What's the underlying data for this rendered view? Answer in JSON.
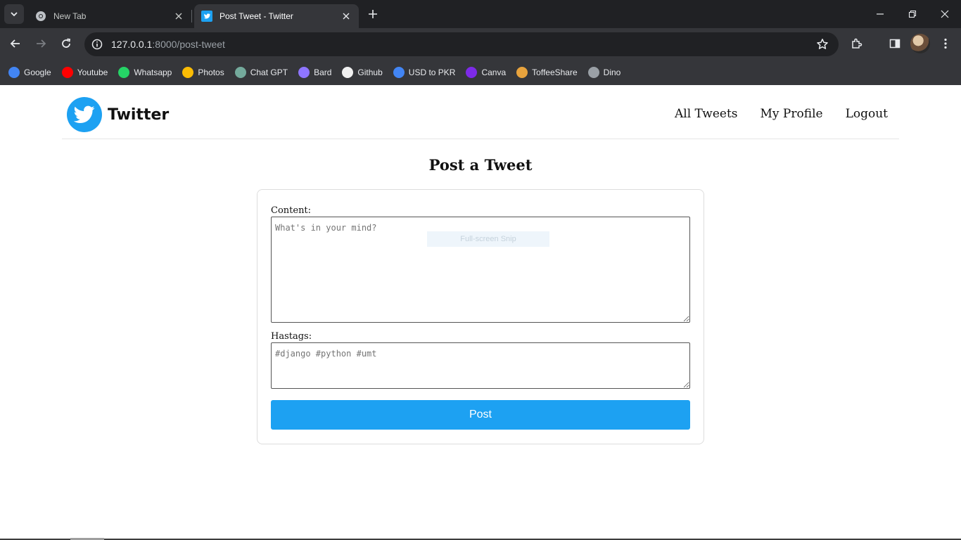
{
  "browser": {
    "tabs": [
      {
        "title": "New Tab",
        "favicon": "chrome-icon",
        "active": false
      },
      {
        "title": "Post Tweet - Twitter",
        "favicon": "twitter-bird-icon",
        "active": true
      }
    ],
    "address": {
      "host": "127.0.0.1",
      "path": ":8000/post-tweet"
    },
    "bookmarks": [
      {
        "label": "Google",
        "icon": "google-icon",
        "color": "#4285f4"
      },
      {
        "label": "Youtube",
        "icon": "youtube-icon",
        "color": "#ff0000"
      },
      {
        "label": "Whatsapp",
        "icon": "whatsapp-icon",
        "color": "#25d366"
      },
      {
        "label": "Photos",
        "icon": "photos-icon",
        "color": "#fbbc04"
      },
      {
        "label": "Chat GPT",
        "icon": "chatgpt-icon",
        "color": "#74aa9c"
      },
      {
        "label": "Bard",
        "icon": "bard-icon",
        "color": "#8e75ff"
      },
      {
        "label": "Github",
        "icon": "github-icon",
        "color": "#f0f0f0"
      },
      {
        "label": "USD to PKR",
        "icon": "google-icon",
        "color": "#4285f4"
      },
      {
        "label": "Canva",
        "icon": "canva-icon",
        "color": "#7d2ae8"
      },
      {
        "label": "ToffeeShare",
        "icon": "toffeeshare-icon",
        "color": "#e8a33d"
      },
      {
        "label": "Dino",
        "icon": "dino-icon",
        "color": "#9aa0a6"
      }
    ]
  },
  "site": {
    "brand": "Twitter",
    "brand_color": "#1da1f2",
    "nav": [
      "All Tweets",
      "My Profile",
      "Logout"
    ]
  },
  "form": {
    "title": "Post a Tweet",
    "content_label": "Content:",
    "content_placeholder": "What's in your mind?",
    "hashtags_label": "Hastags:",
    "hashtags_placeholder": "#django #python #umt",
    "submit_label": "Post"
  },
  "overlay": {
    "snip_label": "Full-screen Snip"
  }
}
